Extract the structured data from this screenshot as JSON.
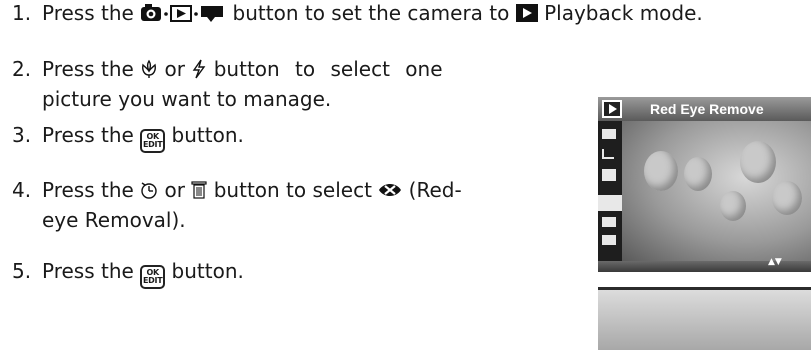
{
  "steps": [
    {
      "num": "1.",
      "a": "Press the",
      "b": "button to set the camera to",
      "c": "Playback mode."
    },
    {
      "num": "2.",
      "a": "Press the",
      "b": "or",
      "c": "button to select one",
      "d": "picture you want to manage."
    },
    {
      "num": "3.",
      "a": "Press the",
      "b": "button."
    },
    {
      "num": "4.",
      "a": "Press the",
      "b": "or",
      "c": "button to select",
      "d": "(Red-",
      "e": "eye Removal)."
    },
    {
      "num": "5.",
      "a": "Press the",
      "b": "button."
    }
  ],
  "ok_button": {
    "line1": "OK",
    "line2": "EDIT"
  },
  "lcd": {
    "title": "Red Eye Remove",
    "nav": "▲▼"
  },
  "icons": [
    "camera-mode-icon",
    "playback-icon",
    "movie-icon",
    "macro-icon",
    "flash-icon",
    "self-timer-icon",
    "trash-icon",
    "red-eye-icon",
    "ok-edit-button-icon"
  ]
}
